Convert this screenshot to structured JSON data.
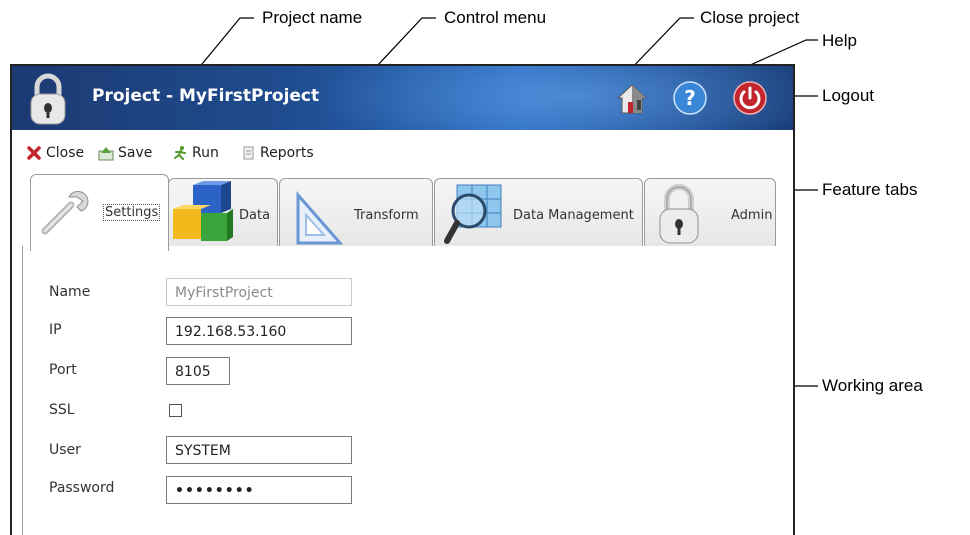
{
  "callouts": {
    "project_name": "Project name",
    "control_menu": "Control menu",
    "close_project": "Close project",
    "help": "Help",
    "logout": "Logout",
    "feature_tabs": "Feature tabs",
    "working_area": "Working area"
  },
  "titlebar": {
    "title": "Project - MyFirstProject",
    "colors": {
      "primary": "#1f4c8f",
      "logout": "#c0262b",
      "help": "#3a87d8"
    }
  },
  "menu": {
    "close": "Close",
    "save": "Save",
    "run": "Run",
    "reports": "Reports"
  },
  "tabs": [
    {
      "label": "Settings",
      "icon": "wrench-icon",
      "active": true
    },
    {
      "label": "Data",
      "icon": "cubes-icon",
      "active": false
    },
    {
      "label": "Transform",
      "icon": "triangle-ruler-icon",
      "active": false
    },
    {
      "label": "Data Management",
      "icon": "magnifier-grid-icon",
      "active": false
    },
    {
      "label": "Admin",
      "icon": "padlock-icon",
      "active": false
    }
  ],
  "form": {
    "name_label": "Name",
    "name_value": "MyFirstProject",
    "ip_label": "IP",
    "ip_value": "192.168.53.160",
    "port_label": "Port",
    "port_value": "8105",
    "ssl_label": "SSL",
    "ssl_checked": false,
    "user_label": "User",
    "user_value": "SYSTEM",
    "password_label": "Password",
    "password_value": "••••••••"
  }
}
